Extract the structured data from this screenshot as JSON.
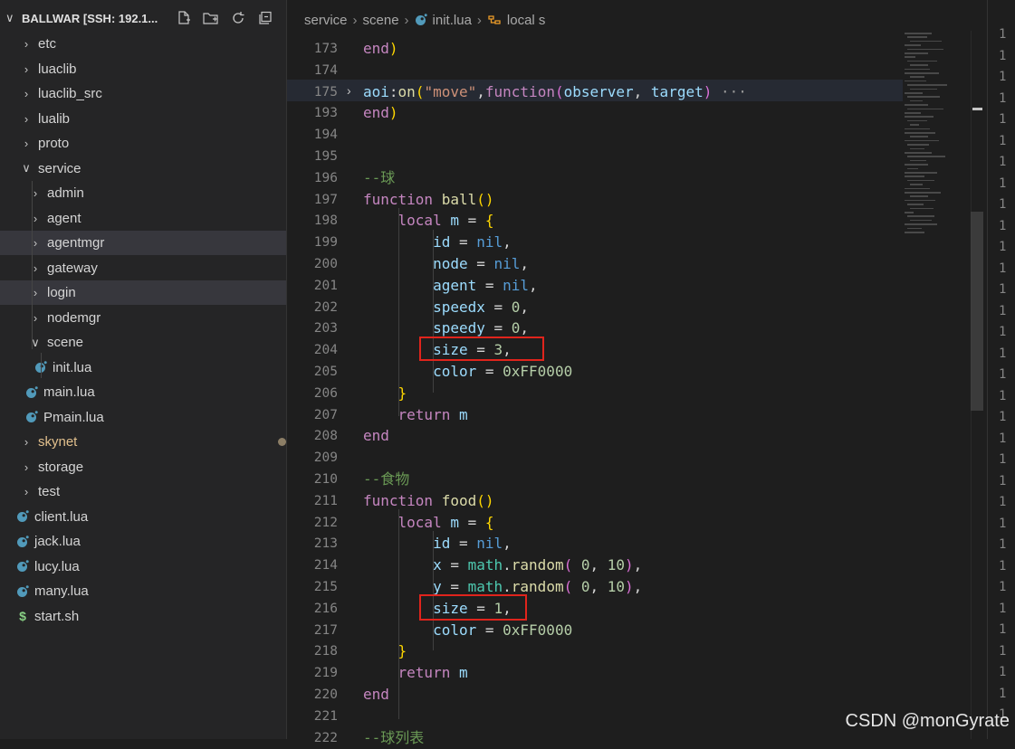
{
  "explorer": {
    "title": "BALLWAR [SSH: 192.1...",
    "actions": [
      "new-file-icon",
      "new-folder-icon",
      "refresh-icon",
      "collapse-icon"
    ],
    "items": [
      {
        "label": "etc",
        "type": "folder",
        "depth": 0,
        "open": false
      },
      {
        "label": "luaclib",
        "type": "folder",
        "depth": 0,
        "open": false
      },
      {
        "label": "luaclib_src",
        "type": "folder",
        "depth": 0,
        "open": false
      },
      {
        "label": "lualib",
        "type": "folder",
        "depth": 0,
        "open": false
      },
      {
        "label": "proto",
        "type": "folder",
        "depth": 0,
        "open": false
      },
      {
        "label": "service",
        "type": "folder",
        "depth": 0,
        "open": true
      },
      {
        "label": "admin",
        "type": "folder",
        "depth": 1,
        "open": false
      },
      {
        "label": "agent",
        "type": "folder",
        "depth": 1,
        "open": false
      },
      {
        "label": "agentmgr",
        "type": "folder",
        "depth": 1,
        "open": false,
        "selected": true
      },
      {
        "label": "gateway",
        "type": "folder",
        "depth": 1,
        "open": false
      },
      {
        "label": "login",
        "type": "folder",
        "depth": 1,
        "open": false,
        "selected": true
      },
      {
        "label": "nodemgr",
        "type": "folder",
        "depth": 1,
        "open": false
      },
      {
        "label": "scene",
        "type": "folder",
        "depth": 1,
        "open": true
      },
      {
        "label": "init.lua",
        "type": "lua",
        "depth": 2
      },
      {
        "label": "main.lua",
        "type": "lua",
        "depth": 1
      },
      {
        "label": "Pmain.lua",
        "type": "lua",
        "depth": 1
      },
      {
        "label": "skynet",
        "type": "folder",
        "depth": 0,
        "open": false,
        "modified": true
      },
      {
        "label": "storage",
        "type": "folder",
        "depth": 0,
        "open": false
      },
      {
        "label": "test",
        "type": "folder",
        "depth": 0,
        "open": false
      },
      {
        "label": "client.lua",
        "type": "lua",
        "depth": 0
      },
      {
        "label": "jack.lua",
        "type": "lua",
        "depth": 0
      },
      {
        "label": "lucy.lua",
        "type": "lua",
        "depth": 0
      },
      {
        "label": "many.lua",
        "type": "lua",
        "depth": 0
      },
      {
        "label": "start.sh",
        "type": "sh",
        "depth": 0
      }
    ]
  },
  "breadcrumb": {
    "parts": [
      "service",
      "scene",
      "init.lua",
      "local s"
    ]
  },
  "code": {
    "lines": [
      {
        "n": "173",
        "html": "<span class='kw'>end</span><span class='brk1'>)</span>"
      },
      {
        "n": "174",
        "html": ""
      },
      {
        "n": "175",
        "html": "<span class='var'>aoi</span>:<span class='fn'>on</span><span class='brk1'>(</span><span class='str'>\"move\"</span>,<span class='kw'>function</span><span class='brk2'>(</span><span class='var'>observer</span>, <span class='var'>target</span><span class='brk2'>)</span> <span class='ellip'>···</span>"
      },
      {
        "n": "193",
        "html": "<span class='kw'>end</span><span class='brk1'>)</span>"
      },
      {
        "n": "194",
        "html": ""
      },
      {
        "n": "195",
        "html": ""
      },
      {
        "n": "196",
        "html": "<span class='cm'>--球</span>"
      },
      {
        "n": "197",
        "html": "<span class='kw'>function</span> <span class='fn'>ball</span><span class='brk1'>()</span>"
      },
      {
        "n": "198",
        "html": "    <span class='kw'>local</span> <span class='var'>m</span> = <span class='brk1'>{</span>"
      },
      {
        "n": "199",
        "html": "        <span class='var'>id</span> = <span class='cst'>nil</span>,"
      },
      {
        "n": "200",
        "html": "        <span class='var'>node</span> = <span class='cst'>nil</span>,"
      },
      {
        "n": "201",
        "html": "        <span class='var'>agent</span> = <span class='cst'>nil</span>,"
      },
      {
        "n": "202",
        "html": "        <span class='var'>speedx</span> = <span class='num'>0</span>,"
      },
      {
        "n": "203",
        "html": "        <span class='var'>speedy</span> = <span class='num'>0</span>,"
      },
      {
        "n": "204",
        "html": "        <span class='var'>size</span> = <span class='num'>3</span>,"
      },
      {
        "n": "205",
        "html": "        <span class='var'>color</span> = <span class='num'>0xFF0000</span>"
      },
      {
        "n": "206",
        "html": "    <span class='brk1'>}</span>"
      },
      {
        "n": "207",
        "html": "    <span class='kw'>return</span> <span class='var'>m</span>"
      },
      {
        "n": "208",
        "html": "<span class='kw'>end</span>"
      },
      {
        "n": "209",
        "html": ""
      },
      {
        "n": "210",
        "html": "<span class='cm'>--食物</span>"
      },
      {
        "n": "211",
        "html": "<span class='kw'>function</span> <span class='fn'>food</span><span class='brk1'>()</span>"
      },
      {
        "n": "212",
        "html": "    <span class='kw'>local</span> <span class='var'>m</span> = <span class='brk1'>{</span>"
      },
      {
        "n": "213",
        "html": "        <span class='var'>id</span> = <span class='cst'>nil</span>,"
      },
      {
        "n": "214",
        "html": "        <span class='var'>x</span> = <span class='obj'>math</span>.<span class='fn'>random</span><span class='brk2'>(</span> <span class='num'>0</span>, <span class='num'>10</span><span class='brk2'>)</span>,"
      },
      {
        "n": "215",
        "html": "        <span class='var'>y</span> = <span class='obj'>math</span>.<span class='fn'>random</span><span class='brk2'>(</span> <span class='num'>0</span>, <span class='num'>10</span><span class='brk2'>)</span>,"
      },
      {
        "n": "216",
        "html": "        <span class='var'>size</span> = <span class='num'>1</span>,"
      },
      {
        "n": "217",
        "html": "        <span class='var'>color</span> = <span class='num'>0xFF0000</span>"
      },
      {
        "n": "218",
        "html": "    <span class='brk1'>}</span>"
      },
      {
        "n": "219",
        "html": "    <span class='kw'>return</span> <span class='var'>m</span>"
      },
      {
        "n": "220",
        "html": "<span class='kw'>end</span>"
      },
      {
        "n": "221",
        "html": ""
      },
      {
        "n": "222",
        "html": "<span class='cm'>--球列表</span>"
      }
    ]
  },
  "right_pane_prefix": "1",
  "watermark": "CSDN @monGyrate",
  "colors": {
    "accent": "#e0241c",
    "lua_icon": "#519aba",
    "modified": "#e2c08d"
  }
}
